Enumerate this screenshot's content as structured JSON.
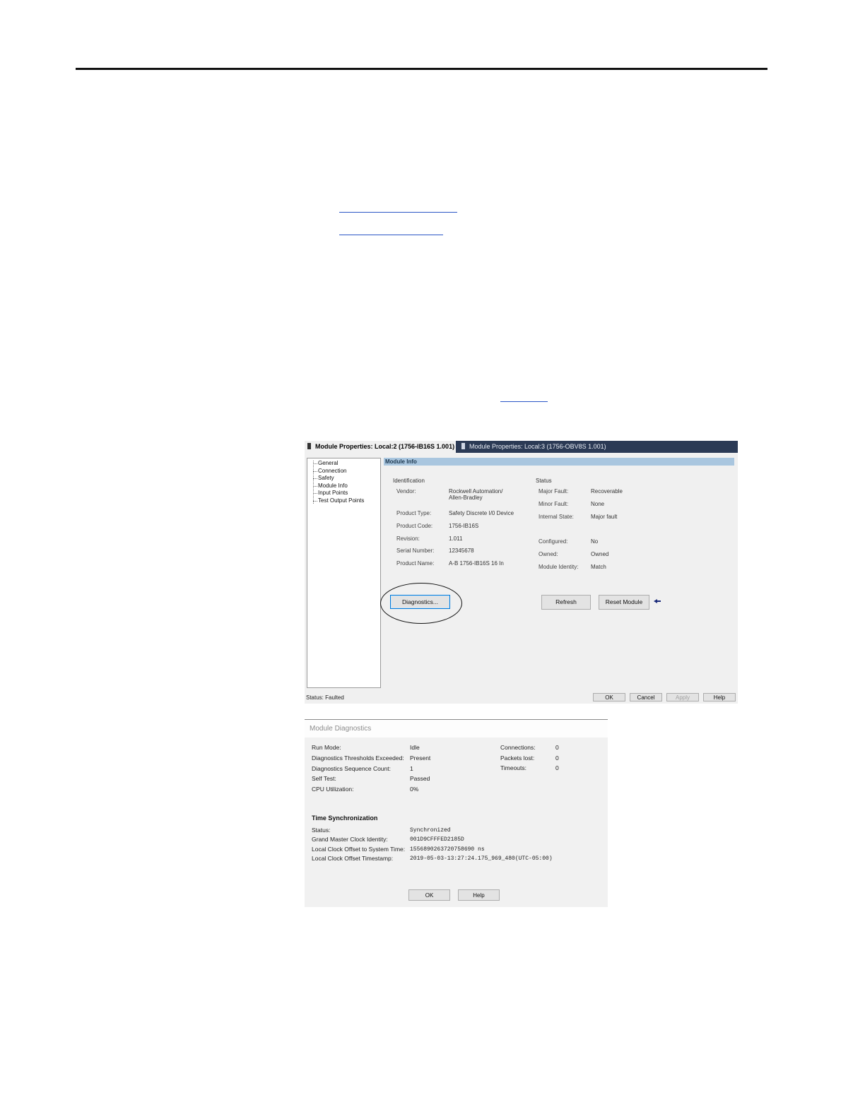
{
  "module_properties": {
    "tabs": [
      {
        "label": "Module Properties: Local:2 (1756-IB16S 1.001)",
        "close": "✕"
      },
      {
        "label": "Module Properties: Local:3 (1756-OBV8S 1.001)"
      }
    ],
    "tree": [
      "General",
      "Connection",
      "Safety",
      "Module Info",
      "Input Points",
      "Test Output Points"
    ],
    "section_header": "Module Info",
    "identification": {
      "title": "Identification",
      "rows": [
        {
          "label": "Vendor:",
          "value": "Rockwell Automation/",
          "value2": "Allen-Bradley"
        },
        {
          "label": "Product Type:",
          "value": "Safety Discrete I/0 Device"
        },
        {
          "label": "Product Code:",
          "value": "1756-IB16S"
        },
        {
          "label": "Revision:",
          "value": "1.011"
        },
        {
          "label": "Serial Number:",
          "value": "12345678"
        },
        {
          "label": "Product Name:",
          "value": "A-B 1756-IB16S 16 In"
        }
      ]
    },
    "status": {
      "title": "Status",
      "rows": [
        {
          "label": "Major Fault:",
          "value": "Recoverable"
        },
        {
          "label": "Minor Fault:",
          "value": "None"
        },
        {
          "label": "Internal State:",
          "value": "Major fault"
        },
        {
          "label": "Configured:",
          "value": "No"
        },
        {
          "label": "Owned:",
          "value": "Owned"
        },
        {
          "label": "Module Identity:",
          "value": "Match"
        }
      ]
    },
    "buttons": {
      "diagnostics": "Diagnostics...",
      "refresh": "Refresh",
      "reset_module": "Reset Module"
    },
    "status_bar": "Status: Faulted",
    "footer_buttons": {
      "ok": "OK",
      "cancel": "Cancel",
      "apply": "Apply",
      "help": "Help"
    }
  },
  "module_diagnostics": {
    "title": "Module Diagnostics",
    "left_rows": [
      {
        "label": "Run Mode:",
        "value": "Idle"
      },
      {
        "label": "Diagnostics Thresholds Exceeded:",
        "value": "Present"
      },
      {
        "label": "Diagnostics Sequence Count:",
        "value": "1"
      },
      {
        "label": "Self Test:",
        "value": "Passed"
      },
      {
        "label": "CPU Utilization:",
        "value": "0%"
      }
    ],
    "right_rows": [
      {
        "label": "Connections:",
        "value": "0"
      },
      {
        "label": "Packets lost:",
        "value": "0"
      },
      {
        "label": "Timeouts:",
        "value": "0"
      }
    ],
    "time_sync": {
      "title": "Time Synchronization",
      "rows": [
        {
          "label": "Status:",
          "value": "Synchronized"
        },
        {
          "label": "Grand Master Clock Identity:",
          "value": "001D9CFFFED2185D"
        },
        {
          "label": "Local Clock Offset to System Time:",
          "value": "1556890263720758690 ns"
        },
        {
          "label": "Local Clock Offset Timestamp:",
          "value": "2019-05-03-13:27:24.175_969_480(UTC-05:00)"
        }
      ]
    },
    "buttons": {
      "ok": "OK",
      "help": "Help"
    }
  }
}
